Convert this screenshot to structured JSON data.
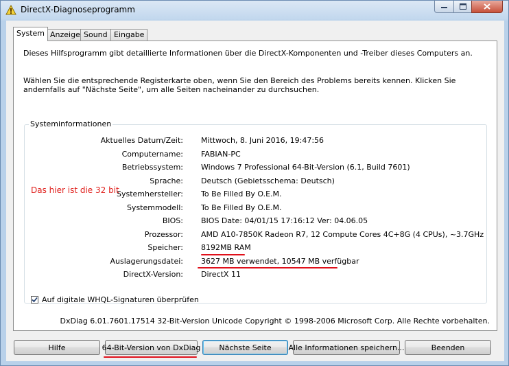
{
  "window": {
    "title": "DirectX-Diagnoseprogramm"
  },
  "tabs": [
    {
      "label": "System"
    },
    {
      "label": "Anzeige"
    },
    {
      "label": "Sound"
    },
    {
      "label": "Eingabe"
    }
  ],
  "intro": {
    "line1": "Dieses Hilfsprogramm gibt detaillierte Informationen über die DirectX-Komponenten und -Treiber dieses Computers an.",
    "line2": "Wählen Sie die entsprechende Registerkarte oben, wenn Sie den Bereich des Problems bereits kennen. Klicken Sie andernfalls auf \"Nächste Seite\", um alle Seiten nacheinander zu durchsuchen."
  },
  "sysinfo": {
    "title": "Systeminformationen",
    "rows": [
      {
        "label": "Aktuelles Datum/Zeit:",
        "value": "Mittwoch, 8. Juni 2016, 19:47:56"
      },
      {
        "label": "Computername:",
        "value": "FABIAN-PC"
      },
      {
        "label": "Betriebssystem:",
        "value": "Windows 7 Professional 64-Bit-Version (6.1, Build 7601)"
      },
      {
        "label": "Sprache:",
        "value": "Deutsch (Gebietsschema: Deutsch)"
      },
      {
        "label": "Systemhersteller:",
        "value": "To Be Filled By O.E.M."
      },
      {
        "label": "Systemmodell:",
        "value": "To Be Filled By O.E.M."
      },
      {
        "label": "BIOS:",
        "value": "BIOS Date: 04/01/15 17:16:12 Ver: 04.06.05"
      },
      {
        "label": "Prozessor:",
        "value": "AMD A10-7850K Radeon R7, 12 Compute Cores 4C+8G (4 CPUs), ~3.7GHz"
      },
      {
        "label": "Speicher:",
        "value": "8192MB RAM"
      },
      {
        "label": "Auslagerungsdatei:",
        "value": "3627 MB verwendet, 10547 MB verfügbar"
      },
      {
        "label": "DirectX-Version:",
        "value": "DirectX 11"
      }
    ],
    "annotation": "Das hier ist die 32 bit",
    "whql_label": "Auf digitale WHQL-Signaturen überprüfen",
    "whql_checked": true
  },
  "copyright": "DxDiag 6.01.7601.17514 32-Bit-Version Unicode Copyright © 1998-2006 Microsoft Corp. Alle Rechte vorbehalten.",
  "buttons": {
    "help": "Hilfe",
    "bit64": "64-Bit-Version von DxDiag",
    "next": "Nächste Seite",
    "save_all": "Alle Informationen speichern...",
    "exit": "Beenden"
  },
  "colors": {
    "annotation_red": "#e0201c",
    "title_bar": "#c3d8ee"
  }
}
